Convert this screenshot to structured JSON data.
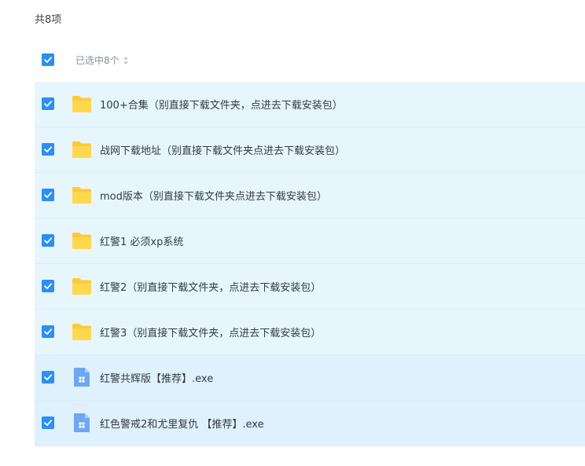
{
  "summary": {
    "total_text": "共8项"
  },
  "header": {
    "selected_text": "已选中8个"
  },
  "colors": {
    "accent": "#2b8ff3",
    "row_bg": "#e7f6fd",
    "folder": "#ffd24d",
    "file_icon": "#6ea8ef"
  },
  "items": [
    {
      "type": "folder",
      "icon": "folder-icon",
      "checked": true,
      "name": "100+合集（别直接下载文件夹，点进去下载安装包）"
    },
    {
      "type": "folder",
      "icon": "folder-icon",
      "checked": true,
      "name": "战网下载地址（别直接下载文件夹点进去下载安装包）"
    },
    {
      "type": "folder",
      "icon": "folder-icon",
      "checked": true,
      "name": "mod版本（别直接下载文件夹点进去下载安装包）"
    },
    {
      "type": "folder",
      "icon": "folder-icon",
      "checked": true,
      "name": "红警1 必须xp系统"
    },
    {
      "type": "folder",
      "icon": "folder-icon",
      "checked": true,
      "name": "红警2（别直接下载文件夹，点进去下载安装包）"
    },
    {
      "type": "folder",
      "icon": "folder-icon",
      "checked": true,
      "name": "红警3（别直接下载文件夹，点进去下载安装包）"
    },
    {
      "type": "file",
      "icon": "exe-file-icon",
      "checked": true,
      "name": "红警共辉版【推荐】.exe"
    },
    {
      "type": "file",
      "icon": "exe-file-icon",
      "checked": true,
      "name": "红色警戒2和尤里复仇 【推荐】.exe"
    }
  ]
}
